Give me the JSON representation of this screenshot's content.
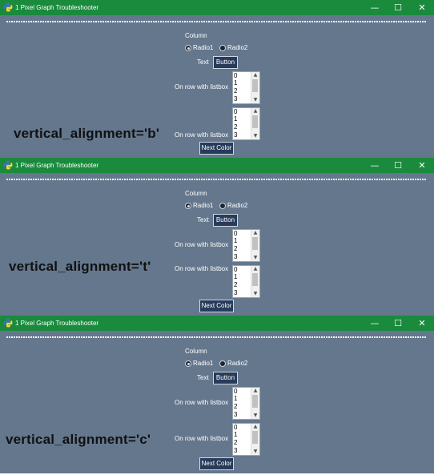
{
  "colors": {
    "titlebar": "#1a8a3d",
    "background": "#64778d",
    "button": "#283b5b"
  },
  "windows": [
    {
      "title": "1 Pixel Graph Troubleshooter",
      "column_label": "Column",
      "radio1": "Radio1",
      "radio2": "Radio2",
      "text_label": "Text",
      "button_label": "Button",
      "row1_label": "On row with listbox",
      "row2_label": "On row with listbox",
      "listbox1": [
        "0",
        "1",
        "2",
        "3"
      ],
      "listbox2": [
        "0",
        "1",
        "2",
        "3"
      ],
      "next_color": "Next Color",
      "overlay": "vertical_alignment='b'"
    },
    {
      "title": "1 Pixel Graph Troubleshooter",
      "column_label": "Column",
      "radio1": "Radio1",
      "radio2": "Radio2",
      "text_label": "Text",
      "button_label": "Button",
      "row1_label": "On row with listbox",
      "row2_label": "On row with listbox",
      "listbox1": [
        "0",
        "1",
        "2",
        "3"
      ],
      "listbox2": [
        "0",
        "1",
        "2",
        "3"
      ],
      "next_color": "Next Color",
      "overlay": "vertical_alignment='t'"
    },
    {
      "title": "1 Pixel Graph Troubleshooter",
      "column_label": "Column",
      "radio1": "Radio1",
      "radio2": "Radio2",
      "text_label": "Text",
      "button_label": "Button",
      "row1_label": "On row with listbox",
      "row2_label": "On row with listbox",
      "listbox1": [
        "0",
        "1",
        "2",
        "3"
      ],
      "listbox2": [
        "0",
        "1",
        "2",
        "3"
      ],
      "next_color": "Next Color",
      "overlay": "vertical_alignment='c'"
    }
  ]
}
